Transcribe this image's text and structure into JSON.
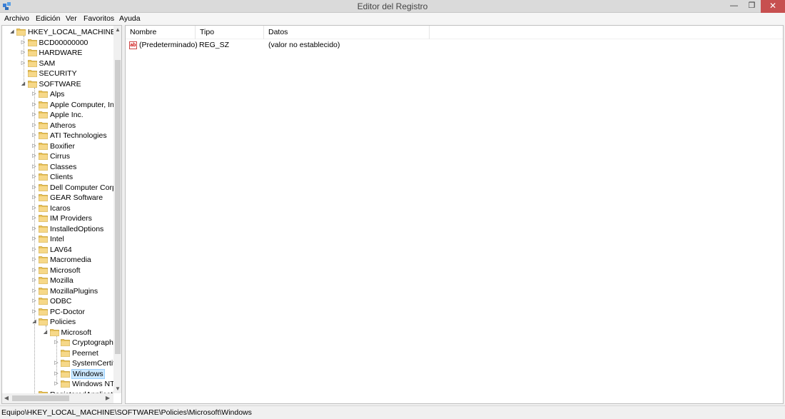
{
  "window": {
    "title": "Editor del Registro",
    "min_glyph": "—",
    "max_glyph": "❐",
    "close_glyph": "✕"
  },
  "menu": [
    "Archivo",
    "Edición",
    "Ver",
    "Favoritos",
    "Ayuda"
  ],
  "tree": [
    {
      "label": "HKEY_LOCAL_MACHINE",
      "level": 0,
      "expander": "expanded"
    },
    {
      "label": "BCD00000000",
      "level": 1,
      "expander": "collapsed"
    },
    {
      "label": "HARDWARE",
      "level": 1,
      "expander": "collapsed"
    },
    {
      "label": "SAM",
      "level": 1,
      "expander": "collapsed"
    },
    {
      "label": "SECURITY",
      "level": 1,
      "expander": "none"
    },
    {
      "label": "SOFTWARE",
      "level": 1,
      "expander": "expanded"
    },
    {
      "label": "Alps",
      "level": 2,
      "expander": "collapsed"
    },
    {
      "label": "Apple Computer, Inc.",
      "level": 2,
      "expander": "collapsed"
    },
    {
      "label": "Apple Inc.",
      "level": 2,
      "expander": "collapsed"
    },
    {
      "label": "Atheros",
      "level": 2,
      "expander": "collapsed"
    },
    {
      "label": "ATI Technologies",
      "level": 2,
      "expander": "collapsed"
    },
    {
      "label": "Boxifier",
      "level": 2,
      "expander": "collapsed"
    },
    {
      "label": "Cirrus",
      "level": 2,
      "expander": "collapsed"
    },
    {
      "label": "Classes",
      "level": 2,
      "expander": "collapsed"
    },
    {
      "label": "Clients",
      "level": 2,
      "expander": "collapsed"
    },
    {
      "label": "Dell Computer Corporation",
      "level": 2,
      "expander": "collapsed"
    },
    {
      "label": "GEAR Software",
      "level": 2,
      "expander": "collapsed"
    },
    {
      "label": "Icaros",
      "level": 2,
      "expander": "collapsed"
    },
    {
      "label": "IM Providers",
      "level": 2,
      "expander": "collapsed"
    },
    {
      "label": "InstalledOptions",
      "level": 2,
      "expander": "collapsed"
    },
    {
      "label": "Intel",
      "level": 2,
      "expander": "collapsed"
    },
    {
      "label": "LAV64",
      "level": 2,
      "expander": "collapsed"
    },
    {
      "label": "Macromedia",
      "level": 2,
      "expander": "collapsed"
    },
    {
      "label": "Microsoft",
      "level": 2,
      "expander": "collapsed"
    },
    {
      "label": "Mozilla",
      "level": 2,
      "expander": "collapsed"
    },
    {
      "label": "MozillaPlugins",
      "level": 2,
      "expander": "collapsed"
    },
    {
      "label": "ODBC",
      "level": 2,
      "expander": "collapsed"
    },
    {
      "label": "PC-Doctor",
      "level": 2,
      "expander": "collapsed"
    },
    {
      "label": "Policies",
      "level": 2,
      "expander": "expanded"
    },
    {
      "label": "Microsoft",
      "level": 3,
      "expander": "expanded"
    },
    {
      "label": "Cryptography",
      "level": 4,
      "expander": "collapsed"
    },
    {
      "label": "Peernet",
      "level": 4,
      "expander": "none"
    },
    {
      "label": "SystemCertificates",
      "level": 4,
      "expander": "collapsed"
    },
    {
      "label": "Windows",
      "level": 4,
      "expander": "collapsed",
      "selected": true
    },
    {
      "label": "Windows NT",
      "level": 4,
      "expander": "collapsed"
    },
    {
      "label": "RegisteredApplications",
      "level": 2,
      "expander": "none"
    }
  ],
  "scroll": {
    "up": "▲",
    "down": "▼",
    "left": "◀",
    "right": "▶"
  },
  "list": {
    "columns": [
      "Nombre",
      "Tipo",
      "Datos"
    ],
    "rows": [
      {
        "icon": "ab",
        "name": "(Predeterminado)",
        "type": "REG_SZ",
        "data": "(valor no establecido)"
      }
    ]
  },
  "status": "Equipo\\HKEY_LOCAL_MACHINE\\SOFTWARE\\Policies\\Microsoft\\Windows",
  "colors": {
    "selection_bg": "#cce8ff",
    "selection_border": "#99d1ff",
    "folder": "#e8c25a",
    "close_button": "#c75050"
  }
}
